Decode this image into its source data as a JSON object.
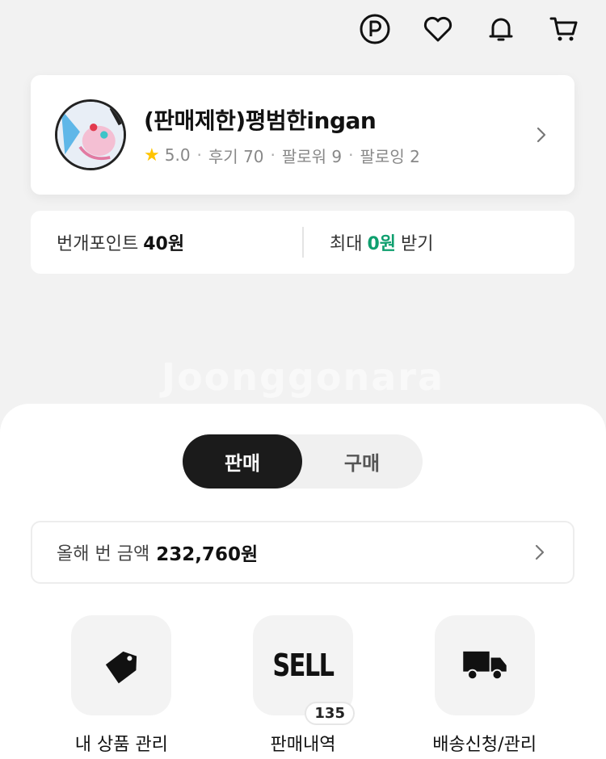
{
  "header": {
    "icons": [
      "point-icon",
      "heart-icon",
      "bell-icon",
      "cart-icon"
    ]
  },
  "profile": {
    "name": "(판매제한)평범한ingan",
    "rating": "5.0",
    "reviews": "후기 70",
    "followers": "팔로워 9",
    "following": "팔로잉 2"
  },
  "points": {
    "label": "번개포인트",
    "value": "40원",
    "max_prefix": "최대",
    "max_value": "0원",
    "max_suffix": "받기"
  },
  "watermark": "Joonggonara",
  "tabs": [
    {
      "label": "판매",
      "active": true
    },
    {
      "label": "구매",
      "active": false
    }
  ],
  "earnings": {
    "label": "올해 번 금액",
    "value": "232,760원"
  },
  "menu": [
    {
      "label": "내 상품 관리",
      "icon": "price-tag-icon"
    },
    {
      "label": "판매내역",
      "icon": "sell-icon",
      "badge": "135",
      "icon_text": "SELL"
    },
    {
      "label": "배송신청/관리",
      "icon": "truck-icon"
    }
  ],
  "colors": {
    "accent_green": "#0e9f6e",
    "star": "#ffc400",
    "active_tab": "#1b1b1b"
  }
}
